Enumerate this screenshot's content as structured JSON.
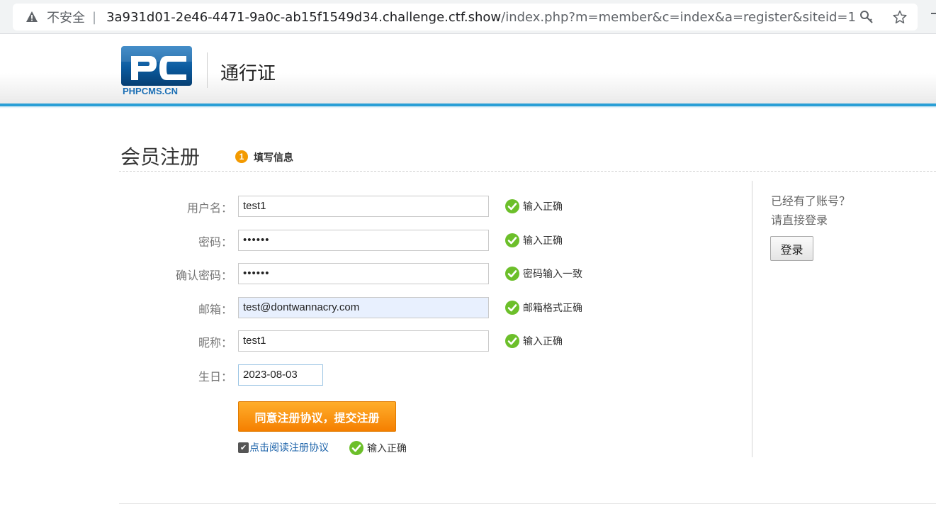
{
  "browser": {
    "security_label": "不安全",
    "separator": "|",
    "url_host": "3a931d01-2e46-4471-9a0c-ab15f1549d34.challenge.ctf.show",
    "url_path": "/index.php?m=member&c=index&a=register&siteid=1"
  },
  "header": {
    "logo_text": "PHPCMS.CN",
    "site_title": "通行证",
    "accent_color": "#2a9fd6"
  },
  "page": {
    "title": "会员注册",
    "step_number": "1",
    "step_label": "填写信息"
  },
  "form": {
    "fields": [
      {
        "label": "用户名：",
        "value": "test1",
        "status": "输入正确"
      },
      {
        "label": "密码：",
        "value": "••••••",
        "status": "输入正确"
      },
      {
        "label": "确认密码：",
        "value": "••••••",
        "status": "密码输入一致"
      },
      {
        "label": "邮箱：",
        "value": "test@dontwannacry.com",
        "status": "邮箱格式正确"
      },
      {
        "label": "昵称：",
        "value": "test1",
        "status": "输入正确"
      },
      {
        "label": "生日：",
        "value": "2023-08-03"
      }
    ],
    "submit_label": "同意注册协议，提交注册",
    "agreement_link": "点击阅读注册协议",
    "agreement_status": "输入正确",
    "agreement_checked": true
  },
  "side": {
    "line1": "已经有了账号？",
    "line2": "请直接登录",
    "login_label": "登录"
  }
}
